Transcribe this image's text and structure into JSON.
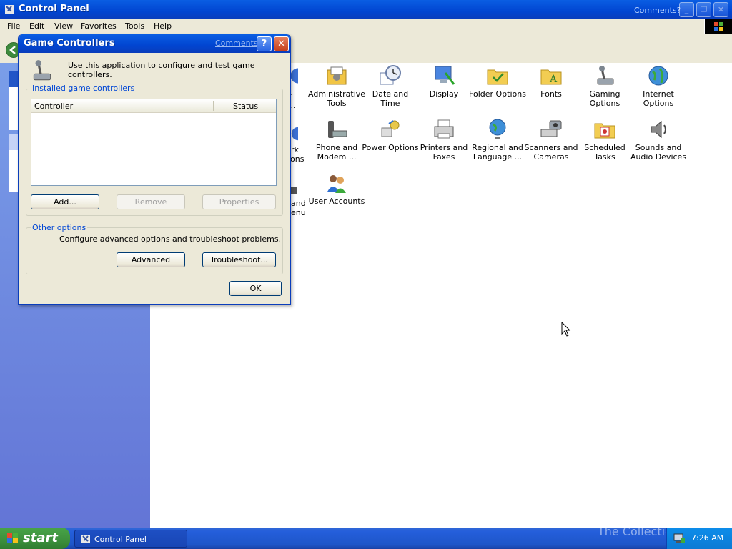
{
  "window": {
    "title": "Control Panel",
    "comments_link": "Comments?",
    "menu": [
      "File",
      "Edit",
      "View",
      "Favorites",
      "Tools",
      "Help"
    ]
  },
  "icons": {
    "row1": [
      {
        "label_partial": "r",
        "label_partial2": "..."
      },
      {
        "label": "Administrative Tools",
        "icon": "admin-tools-icon"
      },
      {
        "label": "Date and Time",
        "icon": "clock-icon"
      },
      {
        "label": "Display",
        "icon": "display-icon"
      },
      {
        "label": "Folder Options",
        "icon": "folder-icon"
      },
      {
        "label": "Fonts",
        "icon": "fonts-folder-icon"
      },
      {
        "label": "Gaming Options",
        "icon": "joystick-icon"
      },
      {
        "label": "Internet Options",
        "icon": "globe-icon"
      }
    ],
    "row2": [
      {
        "label_partial": "rk",
        "label_partial2": "ions"
      },
      {
        "label": "Phone and Modem ...",
        "icon": "phone-icon"
      },
      {
        "label": "Power Options",
        "icon": "power-icon"
      },
      {
        "label": "Printers and Faxes",
        "icon": "printer-icon"
      },
      {
        "label": "Regional and Language ...",
        "icon": "globe-stand-icon"
      },
      {
        "label": "Scanners and Cameras",
        "icon": "scanner-icon"
      },
      {
        "label": "Scheduled Tasks",
        "icon": "task-folder-icon"
      },
      {
        "label": "Sounds and Audio Devices",
        "icon": "speaker-icon"
      }
    ],
    "row3": [
      {
        "label_partial": "and",
        "label_partial2": "enu"
      },
      {
        "label": "User Accounts",
        "icon": "users-icon"
      }
    ]
  },
  "dialog": {
    "title": "Game Controllers",
    "comments_link": "Comments?",
    "help_glyph": "?",
    "close_glyph": "✕",
    "description": "Use this application to configure and test game controllers.",
    "installed_group": "Installed game controllers",
    "columns": [
      "Controller",
      "Status"
    ],
    "buttons": {
      "add": "Add...",
      "remove": "Remove",
      "properties": "Properties",
      "advanced": "Advanced",
      "troubleshoot": "Troubleshoot...",
      "ok": "OK"
    },
    "other_group": "Other options",
    "other_text": "Configure advanced options and troubleshoot problems."
  },
  "taskbar": {
    "start": "start",
    "task": "Control Panel",
    "time": "7:26 AM",
    "watermark": "The Collection Book"
  },
  "colors": {
    "titlebar": "#0145d1",
    "dialog_bg": "#ece9d8",
    "taskbar": "#245edb",
    "start": "#3c8f3c"
  }
}
